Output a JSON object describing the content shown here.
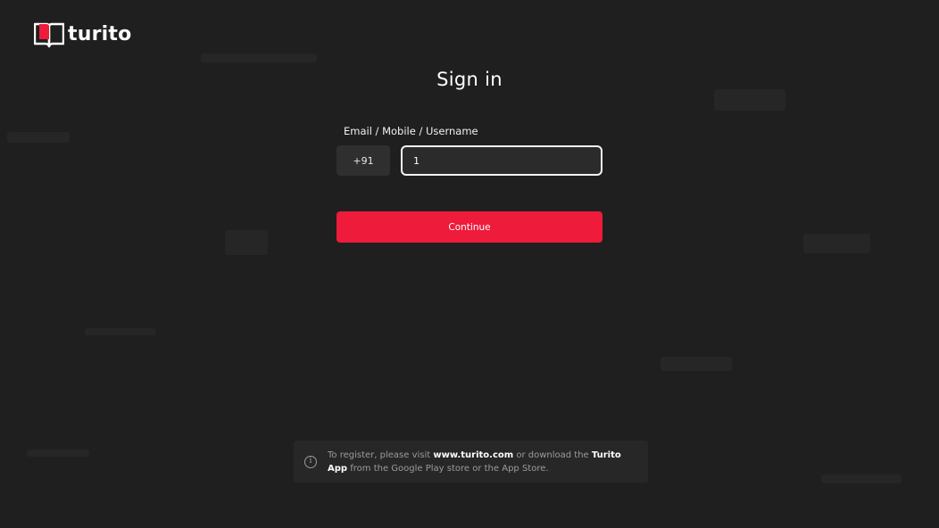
{
  "brand": {
    "name": "turito",
    "accent_color": "#ee1b3b"
  },
  "title": "Sign in",
  "form": {
    "field_label": "Email / Mobile / Username",
    "country_code": "+91",
    "input_value": "1",
    "continue_label": "Continue"
  },
  "info": {
    "icon": "info-icon",
    "text_1": "To register, please visit ",
    "link_site": "www.turito.com",
    "text_2": " or download the ",
    "app_name_1": "Turito",
    "app_name_2": "App",
    "text_3": " from the Google Play store or the App Store."
  }
}
